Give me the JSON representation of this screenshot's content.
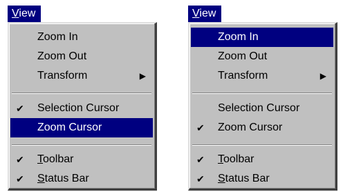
{
  "menus": [
    {
      "title": "View",
      "items": [
        {
          "label": "Zoom In",
          "checked": false,
          "selected": false,
          "submenu": false
        },
        {
          "label": "Zoom Out",
          "checked": false,
          "selected": false,
          "submenu": false
        },
        {
          "label": "Transform",
          "checked": false,
          "selected": false,
          "submenu": true
        },
        {
          "label": "Selection Cursor",
          "checked": true,
          "selected": false,
          "submenu": false
        },
        {
          "label": "Zoom Cursor",
          "checked": false,
          "selected": true,
          "submenu": false
        },
        {
          "label": "Toolbar",
          "checked": true,
          "selected": false,
          "submenu": false
        },
        {
          "label": "Status Bar",
          "checked": true,
          "selected": false,
          "submenu": false
        }
      ]
    },
    {
      "title": "View",
      "items": [
        {
          "label": "Zoom In",
          "checked": false,
          "selected": true,
          "submenu": false
        },
        {
          "label": "Zoom Out",
          "checked": false,
          "selected": false,
          "submenu": false
        },
        {
          "label": "Transform",
          "checked": false,
          "selected": false,
          "submenu": true
        },
        {
          "label": "Selection Cursor",
          "checked": false,
          "selected": false,
          "submenu": false
        },
        {
          "label": "Zoom Cursor",
          "checked": true,
          "selected": false,
          "submenu": false
        },
        {
          "label": "Toolbar",
          "checked": true,
          "selected": false,
          "submenu": false
        },
        {
          "label": "Status Bar",
          "checked": true,
          "selected": false,
          "submenu": false
        }
      ]
    }
  ],
  "glyphs": {
    "check": "✔",
    "submenu_arrow": "▶"
  },
  "colors": {
    "menu_face": "#c0c0c0",
    "highlight": "#000080",
    "highlight_text": "#ffffff"
  }
}
